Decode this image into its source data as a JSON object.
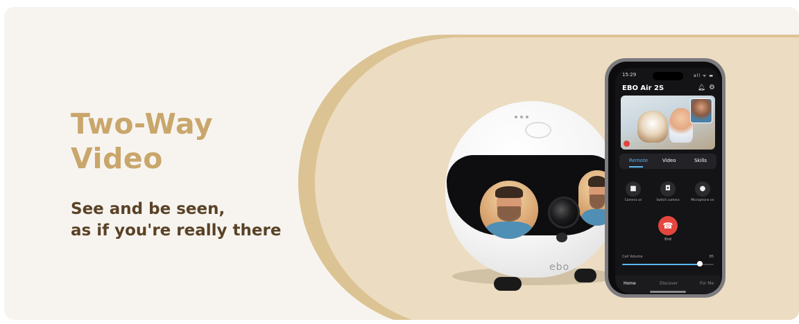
{
  "hero": {
    "headline": [
      "Two-Way",
      "Video"
    ],
    "tagline": [
      "See and be seen,",
      "as if you're really there"
    ]
  },
  "robot": {
    "brand": "ebo"
  },
  "phone": {
    "status_time": "15:29",
    "status_icons": "all ᯤ ▬",
    "app_title": "EBO Air 2S",
    "tabs": [
      "Remote",
      "Video",
      "Skills"
    ],
    "active_tab": "Remote",
    "controls": [
      "Camera on",
      "Switch camera",
      "Microphone on"
    ],
    "end_label": "End",
    "volume_label": "Call Volume",
    "volume_value": "85",
    "volume_level": 0.85,
    "nav": [
      "Home",
      "Discover",
      "For Me"
    ],
    "active_nav": "Home"
  },
  "colors": {
    "headline": "#c9a66b",
    "tagline": "#5a4226",
    "pill": "#ecdcc1",
    "pill_edge": "#dcc394",
    "accent_blue": "#5ab6f0",
    "end_red": "#e4463d"
  },
  "icons": [
    "bell-icon",
    "gear-icon",
    "camera-icon",
    "switch-camera-icon",
    "microphone-icon",
    "phone-end-icon"
  ]
}
